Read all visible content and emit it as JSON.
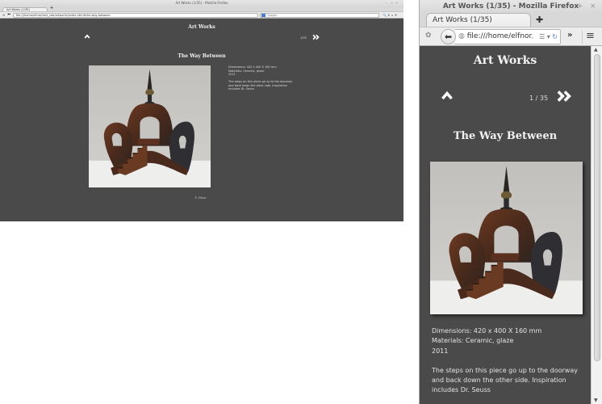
{
  "left_window": {
    "title": "Art Works (1/35) - Mozilla Firefox",
    "window_controls": [
      "–",
      "+",
      "×"
    ],
    "tab_label": "Art Works (1/35)",
    "new_tab": "+",
    "url": "file:///home/elfnor/test_site/artworks/index.html#the-way-between",
    "search_placeholder": "Google",
    "toolbar_icons": "🔍 ⬇ ⌂ ☰"
  },
  "right_window": {
    "title": "Art Works (1/35) - Mozilla Firefox",
    "window_controls": [
      "–",
      "+",
      "×"
    ],
    "tab_label": "Art Works (1/35)",
    "new_tab": "✚",
    "url": "file:///home/elfnor/htı",
    "overflow_label": "»",
    "menu_label": "≡"
  },
  "page": {
    "site_title": "Art Works",
    "counter": "1 / 35",
    "counter_compact": "1/35",
    "artwork": {
      "title": "The Way Between",
      "image_alt": "Ceramic sculpture with arched doorway, spire and steps",
      "dimensions": "Dimensions: 420 x 400 X 160 mm",
      "materials": "Materials: Ceramic, glaze",
      "year": "2011",
      "description": "The steps on this piece go up to the doorway and back down the other side. Inspiration includes Dr. Seuss",
      "credit": "© Elfnor"
    }
  },
  "colors": {
    "page_bg": "#4a4a4a",
    "text": "#f2f2f2",
    "chrome_bg": "#d6d6d6"
  }
}
